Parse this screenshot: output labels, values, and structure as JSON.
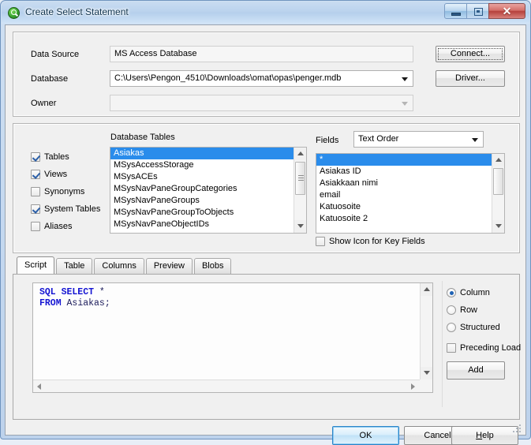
{
  "window": {
    "title": "Create Select Statement",
    "icon": "qlikview-icon",
    "controls": {
      "minimize": "minimize-icon",
      "maximize": "maximize-icon",
      "close": "✕"
    }
  },
  "source_group": {
    "data_source_label": "Data Source",
    "data_source_value": "MS Access Database",
    "database_label": "Database",
    "database_value": "C:\\Users\\Pengon_4510\\Downloads\\omat\\opas\\penger.mdb",
    "owner_label": "Owner",
    "owner_value": "",
    "connect_button": "Connect...",
    "driver_button": "Driver..."
  },
  "tables_group": {
    "filters": [
      {
        "label": "Tables",
        "checked": true
      },
      {
        "label": "Views",
        "checked": true
      },
      {
        "label": "Synonyms",
        "checked": false
      },
      {
        "label": "System Tables",
        "checked": true
      },
      {
        "label": "Aliases",
        "checked": false
      }
    ],
    "database_tables_label": "Database Tables",
    "tables": [
      {
        "name": "Asiakas",
        "selected": true
      },
      {
        "name": "MSysAccessStorage",
        "selected": false
      },
      {
        "name": "MSysACEs",
        "selected": false
      },
      {
        "name": "MSysNavPaneGroupCategories",
        "selected": false
      },
      {
        "name": "MSysNavPaneGroups",
        "selected": false
      },
      {
        "name": "MSysNavPaneGroupToObjects",
        "selected": false
      },
      {
        "name": "MSysNavPaneObjectIDs",
        "selected": false
      }
    ],
    "fields_label": "Fields",
    "fields_order_value": "Text Order",
    "fields": [
      {
        "name": "*",
        "selected": true
      },
      {
        "name": "Asiakas ID",
        "selected": false
      },
      {
        "name": "Asiakkaan nimi",
        "selected": false
      },
      {
        "name": "email",
        "selected": false
      },
      {
        "name": "Katuosoite",
        "selected": false
      },
      {
        "name": "Katuosoite 2",
        "selected": false
      }
    ],
    "show_icon_key_fields": {
      "label": "Show Icon for Key Fields",
      "checked": false
    }
  },
  "tabs": [
    {
      "label": "Script",
      "active": true
    },
    {
      "label": "Table",
      "active": false
    },
    {
      "label": "Columns",
      "active": false
    },
    {
      "label": "Preview",
      "active": false
    },
    {
      "label": "Blobs",
      "active": false
    }
  ],
  "script": {
    "line1_keyword": "SQL SELECT",
    "line1_rest": " *",
    "line2_keyword": "FROM",
    "line2_rest": " Asiakas;"
  },
  "options": {
    "radios": [
      {
        "label": "Column",
        "checked": true
      },
      {
        "label": "Row",
        "checked": false
      },
      {
        "label": "Structured",
        "checked": false
      }
    ],
    "preceding_load": {
      "label": "Preceding Load",
      "checked": false
    },
    "add_button": "Add"
  },
  "footer": {
    "ok_button": "OK",
    "cancel_button": "Cancel",
    "help_button_accel": "H",
    "help_button_rest": "elp"
  },
  "colors": {
    "selection": "#2a8ceb",
    "keyword": "#1414d2",
    "title_text": "#12354f",
    "close_button": "#b5413c"
  }
}
